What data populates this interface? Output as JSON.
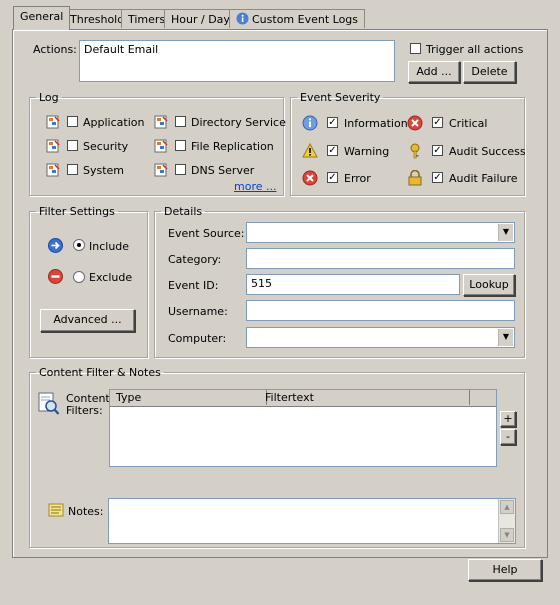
{
  "tabs": [
    "General",
    "Threshold",
    "Timers",
    "Hour / Day",
    "Custom Event Logs"
  ],
  "actions": {
    "label": "Actions:",
    "value": "Default Email",
    "trigger_all_label": "Trigger all actions",
    "add_label": "Add ...",
    "delete_label": "Delete"
  },
  "log": {
    "title": "Log",
    "items": [
      "Application",
      "Security",
      "System",
      "Directory Service",
      "File Replication",
      "DNS Server"
    ],
    "more_label": "more ..."
  },
  "severity": {
    "title": "Event Severity",
    "items": [
      "Information",
      "Warning",
      "Error",
      "Critical",
      "Audit Success",
      "Audit Failure"
    ]
  },
  "filter": {
    "title": "Filter Settings",
    "include_label": "Include",
    "exclude_label": "Exclude",
    "advanced_label": "Advanced ..."
  },
  "details": {
    "title": "Details",
    "event_source_label": "Event Source:",
    "event_source_value": "",
    "category_label": "Category:",
    "category_value": "",
    "event_id_label": "Event ID:",
    "event_id_value": "515",
    "lookup_label": "Lookup",
    "username_label": "Username:",
    "username_value": "",
    "computer_label": "Computer:",
    "computer_value": ""
  },
  "content": {
    "title": "Content Filter & Notes",
    "filters_label_1": "Content",
    "filters_label_2": "Filters:",
    "columns": [
      "Type",
      "Filtertext"
    ],
    "plus_label": "+",
    "minus_label": "-",
    "notes_label": "Notes:"
  },
  "help_label": "Help"
}
